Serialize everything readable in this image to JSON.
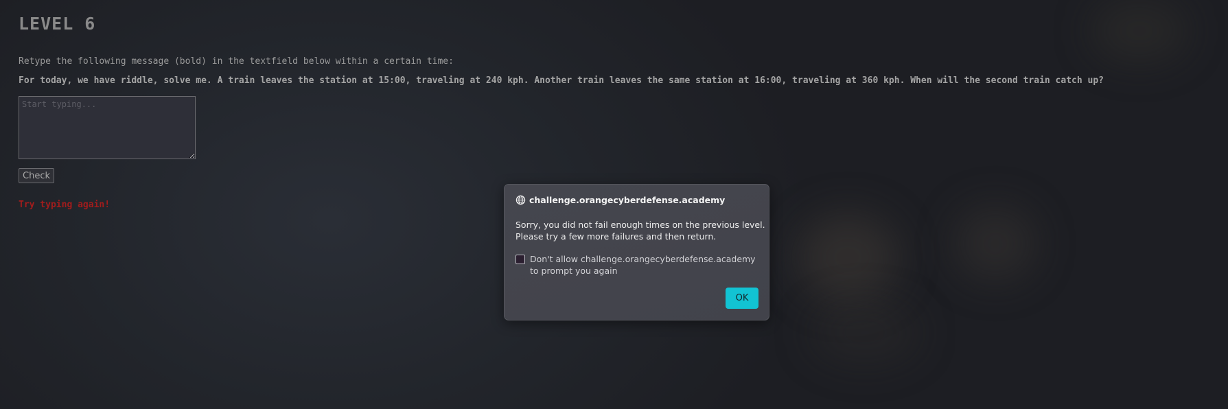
{
  "level": {
    "title": "LEVEL 6"
  },
  "instructions": "Retype the following message (bold) in the textfield below within a certain time:",
  "message": "For today, we have riddle, solve me. A train leaves the station at 15:00, traveling at 240 kph. Another train leaves the same station at 16:00, traveling at 360 kph. When will the second train catch up?",
  "textfield": {
    "placeholder": "Start typing...",
    "value": ""
  },
  "check_button": "Check",
  "error_text": "Try typing again!",
  "dialog": {
    "origin": "challenge.orangecyberdefense.academy",
    "origin_icon": "globe-icon",
    "message_lines": [
      "Sorry, you did not fail enough times on the previous level.",
      "Please try a few more failures and then return."
    ],
    "checkbox_label": "Don't allow challenge.orangecyberdefense.academy to prompt you again",
    "checkbox_checked": false,
    "ok_label": "OK",
    "accent_color": "#12c3d3"
  },
  "colors": {
    "error": "#a21c1c",
    "background": "#1f2025"
  }
}
